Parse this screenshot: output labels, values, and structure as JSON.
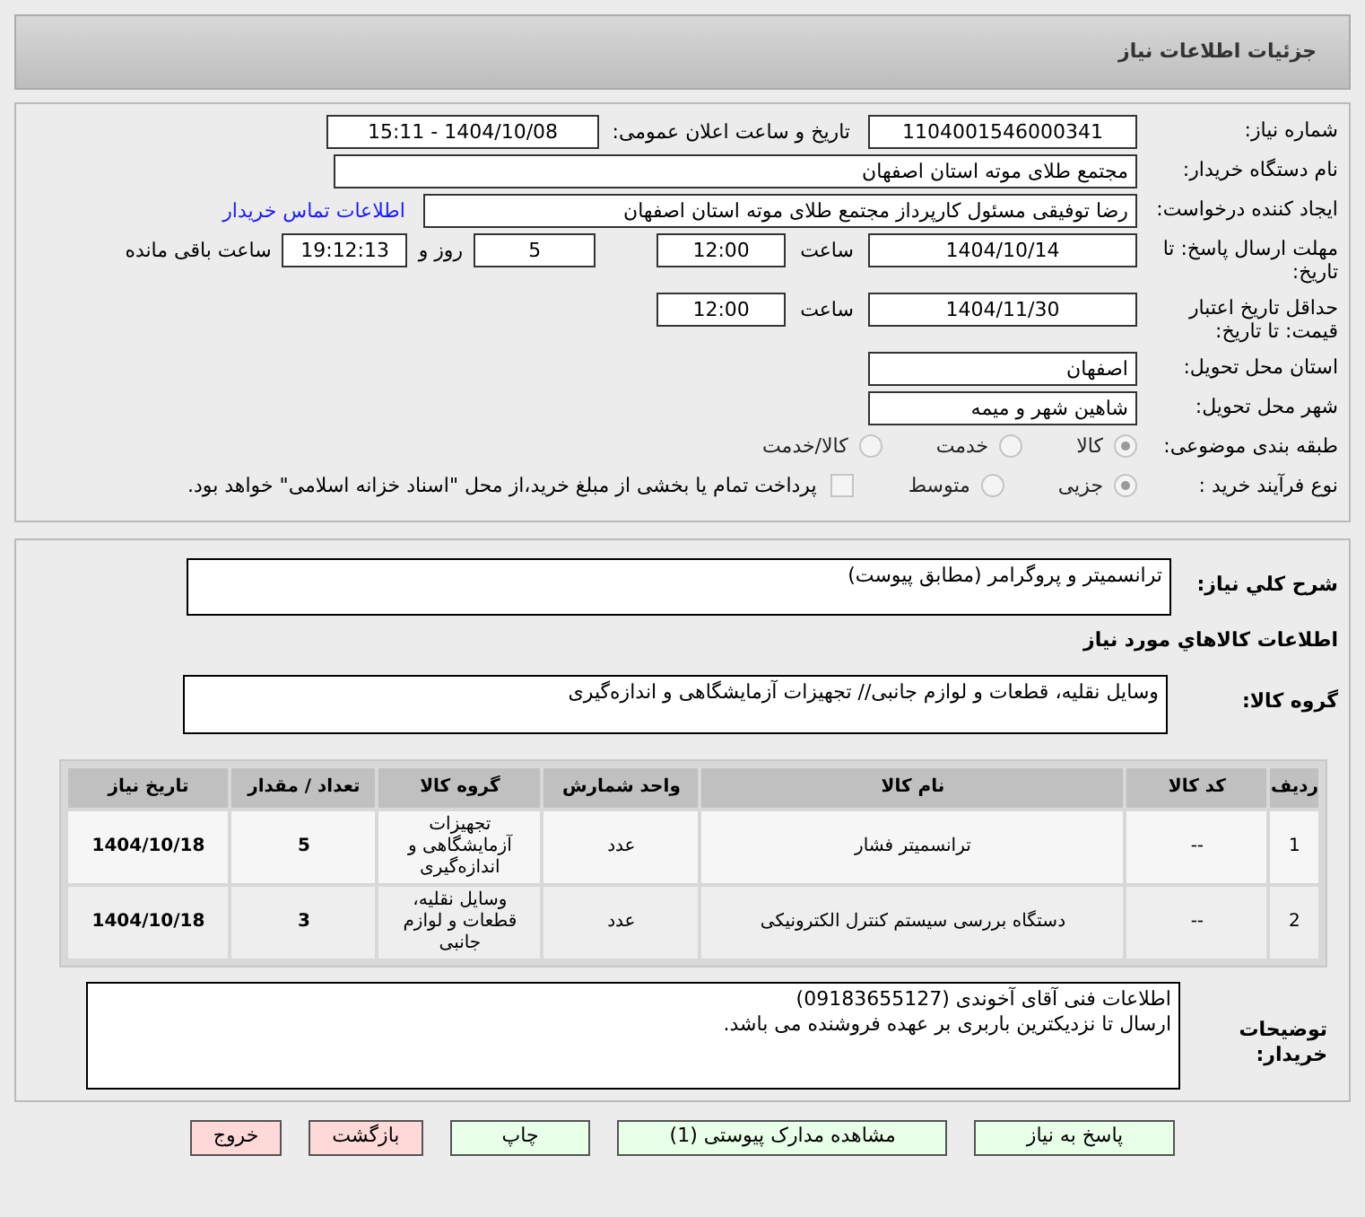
{
  "header": {
    "title": "جزئیات اطلاعات نیاز"
  },
  "need": {
    "number_label": "شماره نیاز:",
    "number": "1104001546000341",
    "announce_label": "تاریخ و ساعت اعلان عمومی:",
    "announce": "1404/10/08 - 15:11",
    "buyer_label": "نام دستگاه خریدار:",
    "buyer": "مجتمع طلای موته استان اصفهان",
    "creator_label": "ایجاد کننده درخواست:",
    "creator": "رضا توفیقی مسئول کارپرداز مجتمع طلای موته استان اصفهان",
    "contact_link": "اطلاعات تماس خریدار",
    "deadline_label": "مهلت ارسال پاسخ: تا تاریخ:",
    "deadline_date": "1404/10/14",
    "time_label": "ساعت",
    "deadline_time": "12:00",
    "days": "5",
    "days_label": "روز و",
    "remaining": "19:12:13",
    "remaining_label": "ساعت باقی مانده",
    "validity_label": "حداقل تاریخ اعتبار قیمت: تا تاریخ:",
    "validity_date": "1404/11/30",
    "validity_time_label": "ساعت",
    "validity_time": "12:00",
    "province_label": "استان محل تحویل:",
    "province": "اصفهان",
    "city_label": "شهر محل تحویل:",
    "city": "شاهین شهر و میمه",
    "category_label": "طبقه بندی موضوعی:",
    "category_options": [
      {
        "label": "کالا",
        "selected": true
      },
      {
        "label": "خدمت",
        "selected": false
      },
      {
        "label": "کالا/خدمت",
        "selected": false
      }
    ],
    "process_label": "نوع فرآیند خرید :",
    "process_options": [
      {
        "label": "جزیی",
        "selected": true
      },
      {
        "label": "متوسط",
        "selected": false
      }
    ],
    "payment_checked": false,
    "payment_text": "پرداخت تمام یا بخشی از مبلغ خرید،از محل \"اسناد خزانه اسلامی\" خواهد بود."
  },
  "details": {
    "summary_label": "شرح کلي نیاز:",
    "summary": "ترانسمیتر و پروگرامر (مطابق پیوست)",
    "goods_title": "اطلاعات کالاهاي مورد نیاز",
    "group_label": "گروه کالا:",
    "group": "وسایل نقلیه، قطعات و لوازم جانبی// تجهیزات آزمایشگاهی و اندازه‌گیری",
    "table": {
      "columns": [
        "ردیف",
        "کد کالا",
        "نام کالا",
        "واحد شمارش",
        "گروه کالا",
        "تعداد / مقدار",
        "تاریخ نیاز"
      ],
      "rows": [
        [
          "1",
          "--",
          "ترانسمیتر فشار",
          "عدد",
          "تجهیزات آزمایشگاهی و اندازه‌گیری",
          "5",
          "1404/10/18"
        ],
        [
          "2",
          "--",
          "دستگاه بررسی سیستم کنترل الکترونیکی",
          "عدد",
          "وسایل نقلیه، قطعات و لوازم جانبی",
          "3",
          "1404/10/18"
        ]
      ]
    },
    "notes_label": "توضیحات خریدار:",
    "notes": [
      "اطلاعات فنی آقای آخوندی (09183655127)",
      "ارسال تا نزدیکترین باربری بر عهده فروشنده می باشد."
    ]
  },
  "buttons": [
    {
      "label": "پاسخ به نیاز",
      "kind": "action"
    },
    {
      "label": "مشاهده مدارک پیوستی (1)",
      "kind": "action"
    },
    {
      "label": "چاپ",
      "kind": "action"
    },
    {
      "label": "بازگشت",
      "kind": "exit"
    },
    {
      "label": "خروج",
      "kind": "exit"
    }
  ]
}
